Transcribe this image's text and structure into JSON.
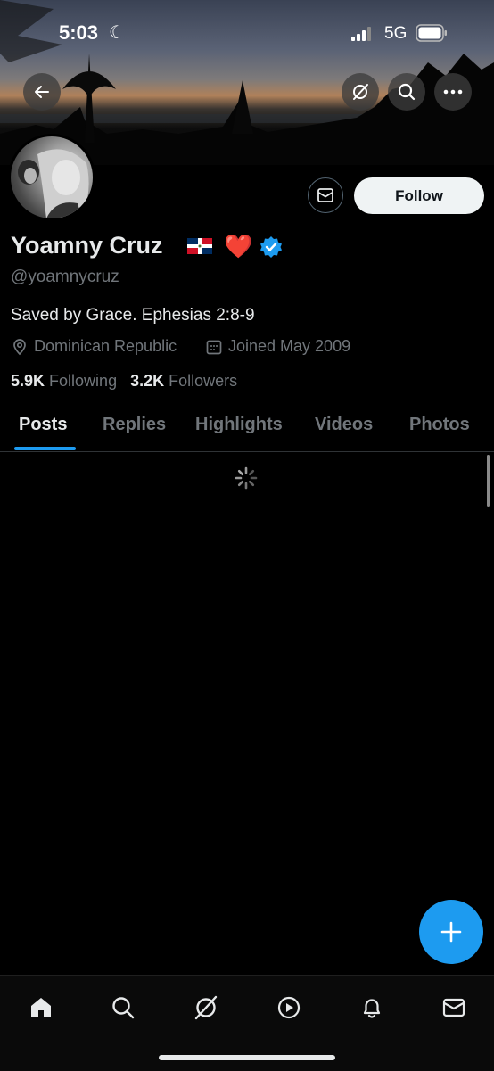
{
  "status_bar": {
    "time": "5:03",
    "network": "5G"
  },
  "header": {
    "back_icon": "arrow-left-icon",
    "grok_icon": "grok-icon",
    "search_icon": "search-icon",
    "more_icon": "more-horizontal-icon"
  },
  "profile": {
    "name": "Yoamny Cruz",
    "handle": "@yoamnycruz",
    "bio": "Saved by Grace. Ephesias 2:8-9",
    "location": "Dominican Republic",
    "joined": "Joined May 2009",
    "following_count": "5.9K",
    "following_label": "Following",
    "followers_count": "3.2K",
    "followers_label": "Followers",
    "follow_label": "Follow",
    "heart_emoji": "❤️"
  },
  "tabs": [
    {
      "label": "Posts",
      "active": true
    },
    {
      "label": "Replies",
      "active": false
    },
    {
      "label": "Highlights",
      "active": false
    },
    {
      "label": "Videos",
      "active": false
    },
    {
      "label": "Photos",
      "active": false
    }
  ],
  "bottom_nav": [
    "home-icon",
    "search-icon",
    "grok-icon",
    "play-icon",
    "bell-icon",
    "mail-icon"
  ],
  "colors": {
    "accent": "#1d9bf0",
    "background": "#000000",
    "muted": "#71767b"
  }
}
